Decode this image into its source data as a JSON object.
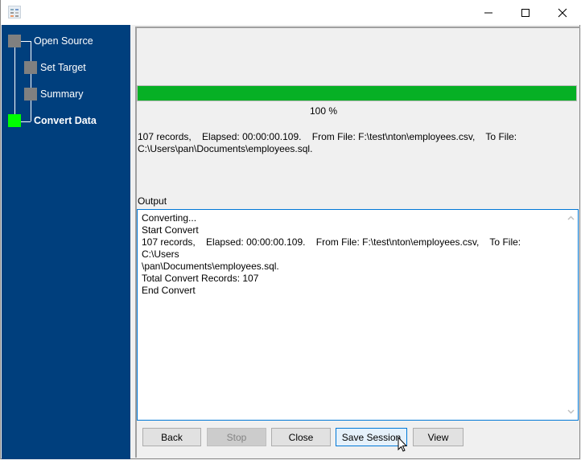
{
  "window": {
    "icon": "app-icon",
    "controls": {
      "minimize": "minimize-icon",
      "maximize": "maximize-icon",
      "close": "close-icon"
    }
  },
  "sidebar": {
    "steps": [
      {
        "label": "Open Source",
        "state": "done"
      },
      {
        "label": "Set Target",
        "state": "done"
      },
      {
        "label": "Summary",
        "state": "done"
      },
      {
        "label": "Convert Data",
        "state": "current"
      }
    ],
    "colors": {
      "background": "#003f7d",
      "done": "#808080",
      "current": "#00ff00"
    }
  },
  "progress": {
    "value_percent": 100,
    "label": "100 %",
    "color": "#06b025"
  },
  "status": {
    "line1": "107 records,    Elapsed: 00:00:00.109.    From File: F:\\test\\nton\\employees.csv,    To File:",
    "line2": "C:\\Users\\pan\\Documents\\employees.sql."
  },
  "output": {
    "label": "Output",
    "lines": "Converting...\nStart Convert\n107 records,    Elapsed: 00:00:00.109.    From File: F:\\test\\nton\\employees.csv,    To File: C:\\Users\n\\pan\\Documents\\employees.sql.\nTotal Convert Records: 107\nEnd Convert"
  },
  "buttons": {
    "back": "Back",
    "stop": "Stop",
    "close": "Close",
    "save_session": "Save Session",
    "view": "View"
  }
}
